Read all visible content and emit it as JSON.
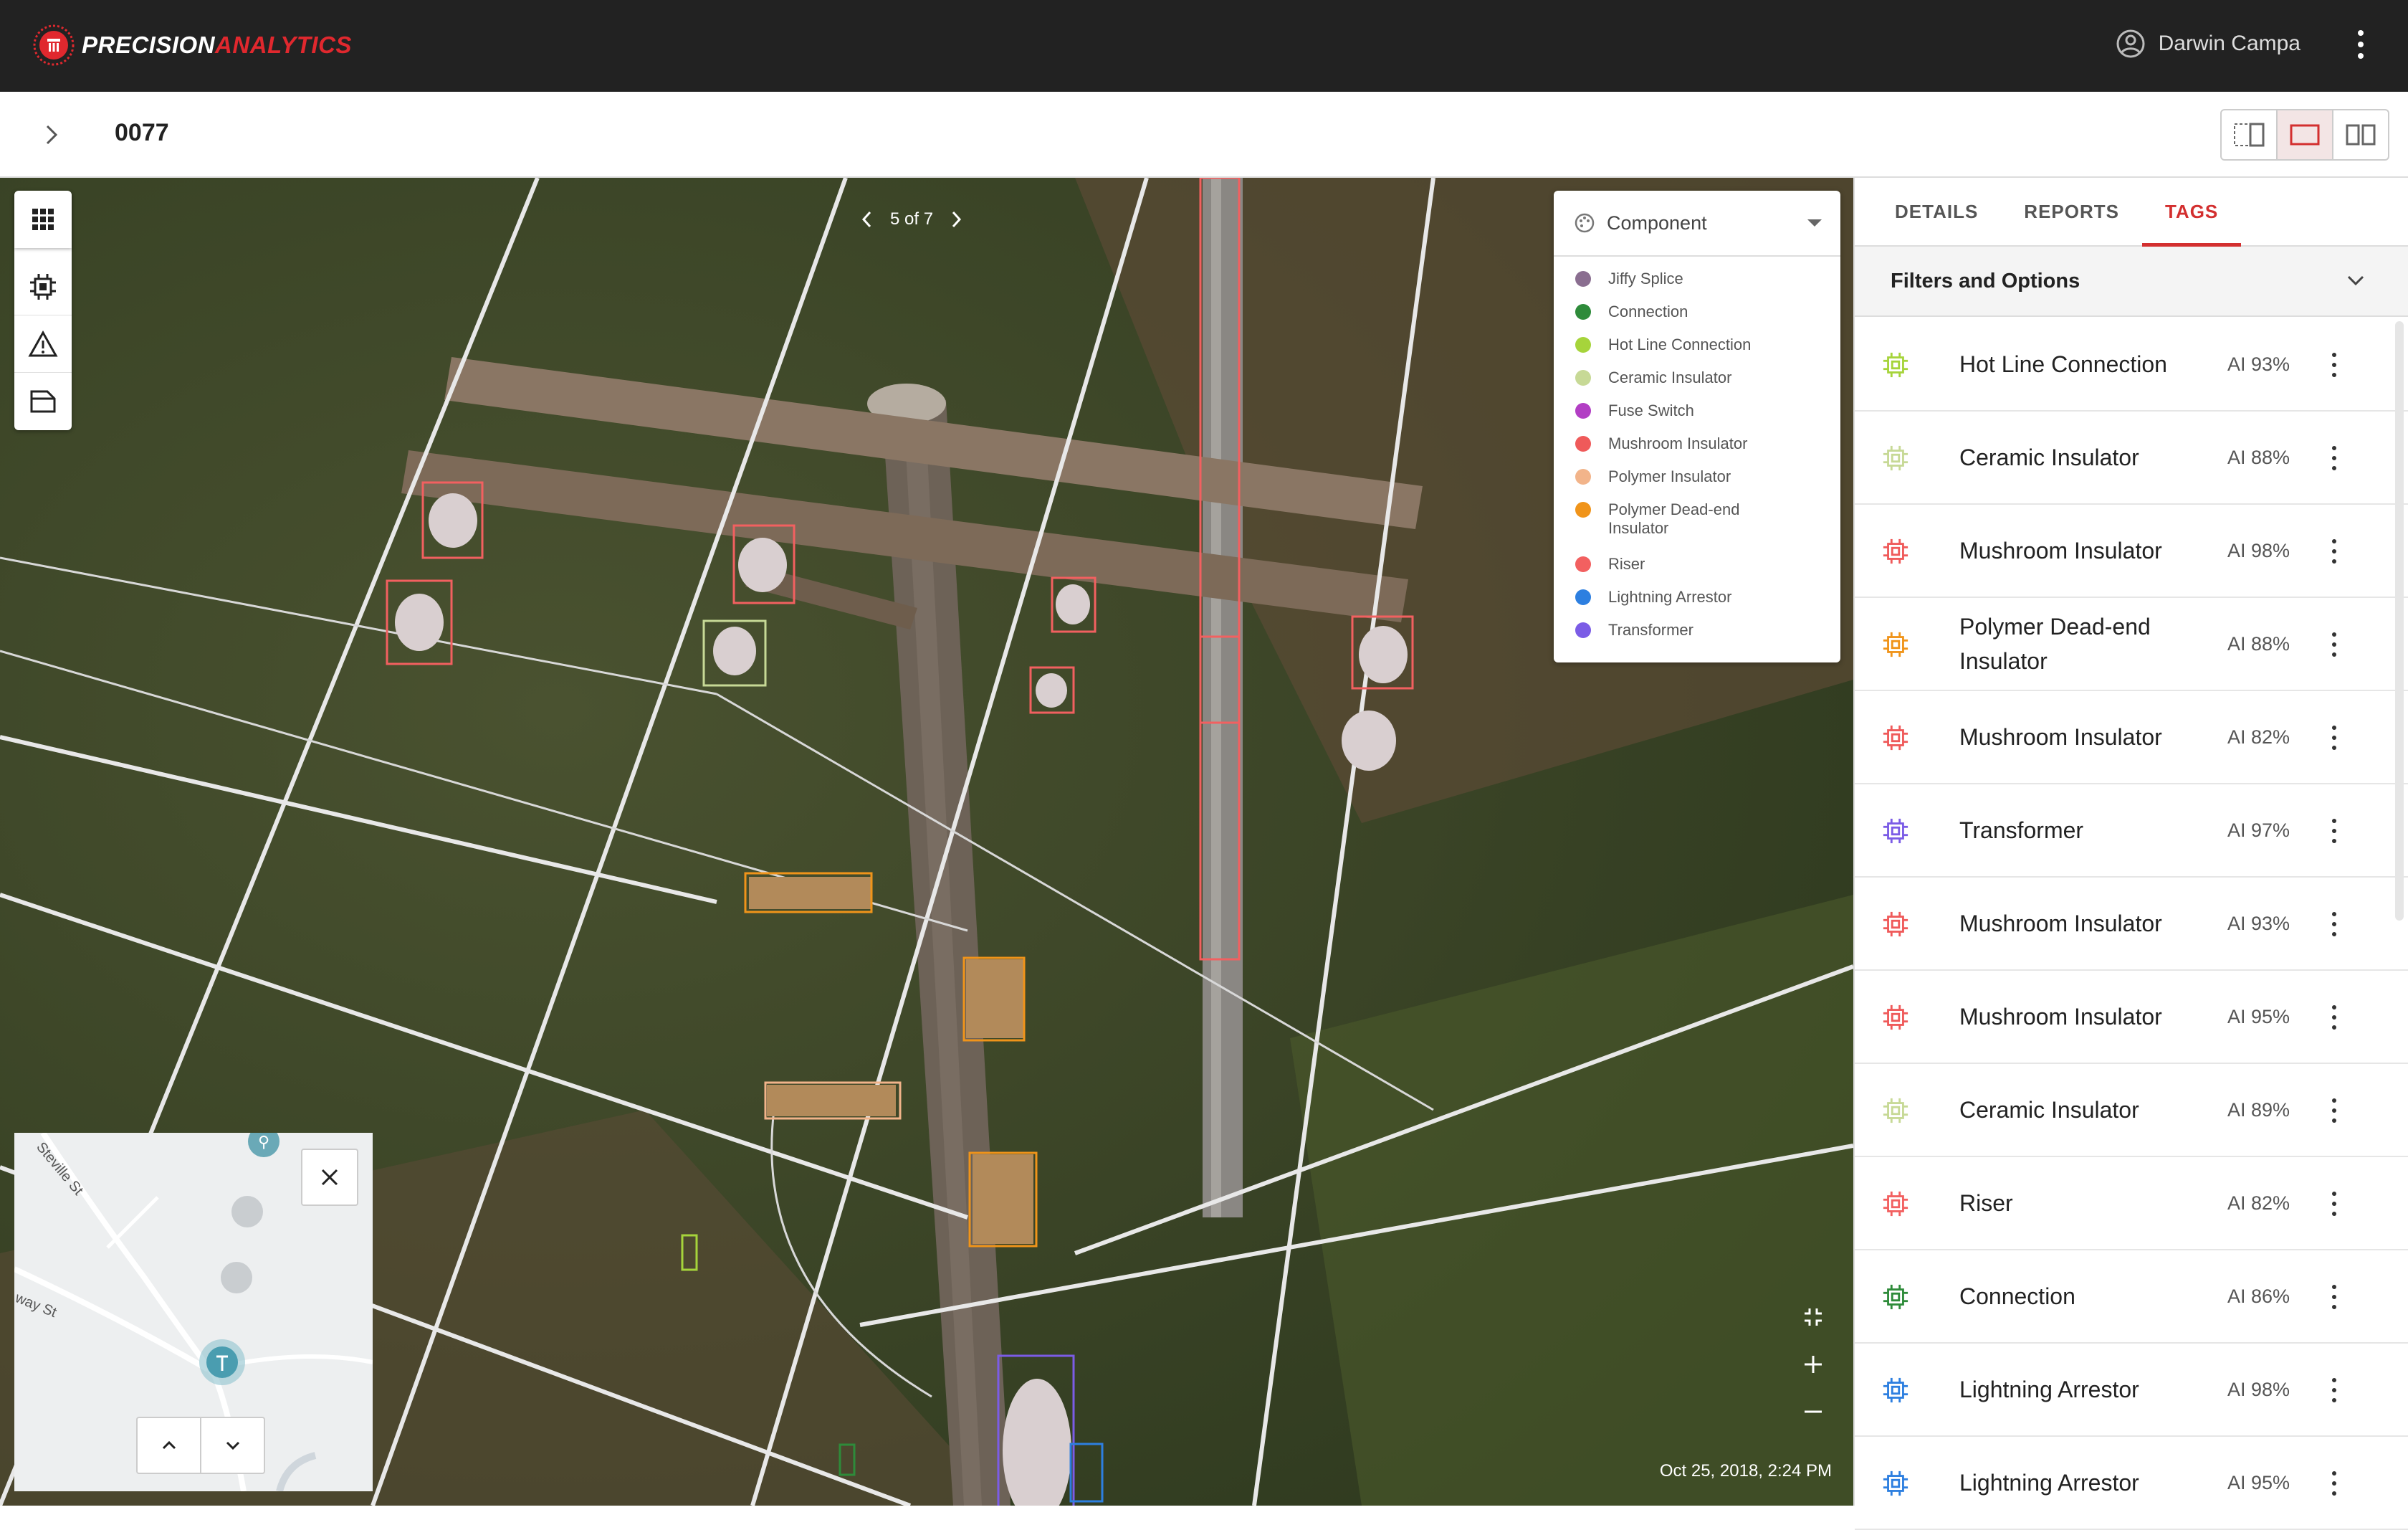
{
  "app": {
    "brand_part1": "PRECISION",
    "brand_part2": "ANALYTICS",
    "user_name": "Darwin Campa"
  },
  "header": {
    "asset_id": "0077"
  },
  "viewer": {
    "pager": "5 of 7",
    "timestamp": "Oct 25, 2018, 2:24 PM",
    "minimap": {
      "street1": "Steville St",
      "street2": "way St"
    }
  },
  "legend": {
    "title": "Component",
    "items": [
      {
        "label": "Jiffy Splice",
        "color": "#8a6e90"
      },
      {
        "label": "Connection",
        "color": "#2e8b3a"
      },
      {
        "label": "Hot Line Connection",
        "color": "#a6d43b"
      },
      {
        "label": "Ceramic Insulator",
        "color": "#c7d996"
      },
      {
        "label": "Fuse Switch",
        "color": "#b23ec4"
      },
      {
        "label": "Mushroom Insulator",
        "color": "#ef5a5a"
      },
      {
        "label": "Polymer Insulator",
        "color": "#f2b48a"
      },
      {
        "label": "Polymer Dead-end Insulator",
        "color": "#f0941a"
      },
      {
        "label": "Riser",
        "color": "#f26060"
      },
      {
        "label": "Lightning Arrestor",
        "color": "#2d7fe0"
      },
      {
        "label": "Transformer",
        "color": "#7b5ce6"
      }
    ]
  },
  "panel": {
    "tabs": [
      "DETAILS",
      "REPORTS",
      "TAGS"
    ],
    "filters_label": "Filters and Options",
    "tags": [
      {
        "name": "Hot Line Connection",
        "ai": "AI 93%",
        "color": "#a6d43b"
      },
      {
        "name": "Ceramic Insulator",
        "ai": "AI 88%",
        "color": "#c7d996"
      },
      {
        "name": "Mushroom Insulator",
        "ai": "AI 98%",
        "color": "#ef5a5a"
      },
      {
        "name": "Polymer Dead-end Insulator",
        "ai": "AI 88%",
        "color": "#f0941a"
      },
      {
        "name": "Mushroom Insulator",
        "ai": "AI 82%",
        "color": "#ef5a5a"
      },
      {
        "name": "Transformer",
        "ai": "AI 97%",
        "color": "#7b5ce6"
      },
      {
        "name": "Mushroom Insulator",
        "ai": "AI 93%",
        "color": "#ef5a5a"
      },
      {
        "name": "Mushroom Insulator",
        "ai": "AI 95%",
        "color": "#ef5a5a"
      },
      {
        "name": "Ceramic Insulator",
        "ai": "AI 89%",
        "color": "#c7d996"
      },
      {
        "name": "Riser",
        "ai": "AI 82%",
        "color": "#f26060"
      },
      {
        "name": "Connection",
        "ai": "AI 86%",
        "color": "#2e8b3a"
      },
      {
        "name": "Lightning Arrestor",
        "ai": "AI 98%",
        "color": "#2d7fe0"
      },
      {
        "name": "Lightning Arrestor",
        "ai": "AI 95%",
        "color": "#2d7fe0"
      }
    ]
  }
}
